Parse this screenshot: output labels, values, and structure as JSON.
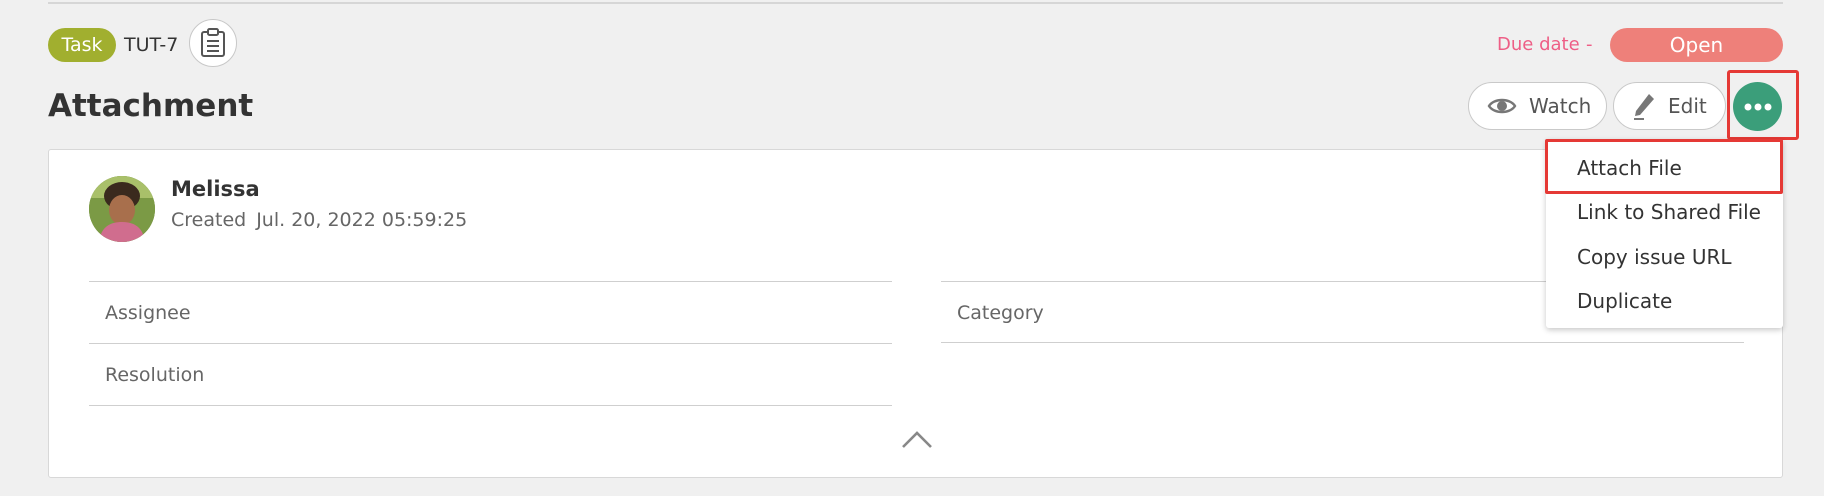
{
  "issue": {
    "type": "Task",
    "key": "TUT-7",
    "title": "Attachment",
    "due_label": "Due date",
    "due_value": "-",
    "status": "Open"
  },
  "actions": {
    "watch": "Watch",
    "edit": "Edit"
  },
  "author": {
    "name": "Melissa",
    "created_label": "Created",
    "created_date": "Jul. 20, 2022 05:59:25"
  },
  "fields": {
    "assignee": "Assignee",
    "category": "Category",
    "resolution": "Resolution"
  },
  "menu": {
    "items": [
      "Attach File",
      "Link to Shared File",
      "Copy issue URL",
      "Duplicate"
    ]
  },
  "colors": {
    "task_badge": "#a1af2f",
    "status_open": "#ee807a",
    "due_date": "#ee5e86",
    "more_button": "#3b9e7a",
    "highlight": "#e53935"
  },
  "icons": {
    "copy": "clipboard-icon",
    "watch": "eye-icon",
    "edit": "pencil-icon",
    "more": "more-horizontal-icon",
    "collapse": "chevron-up-icon"
  }
}
